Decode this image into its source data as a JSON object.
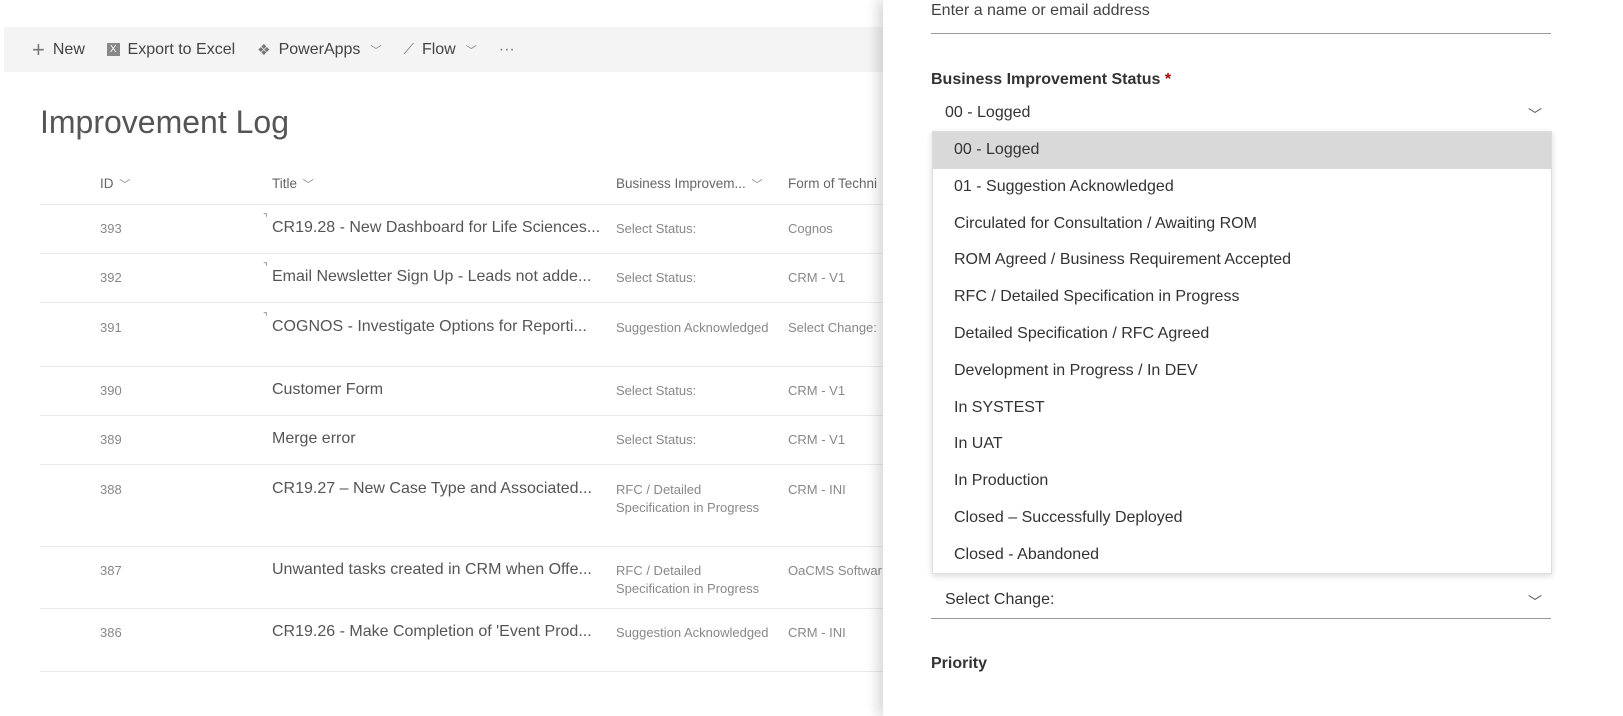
{
  "toolbar": {
    "new": "New",
    "export": "Export to Excel",
    "powerapps": "PowerApps",
    "flow": "Flow",
    "more": "···"
  },
  "list": {
    "title": "Improvement Log",
    "columns": {
      "id": "ID",
      "title": "Title",
      "status": "Business Improvem...",
      "form": "Form of Techni"
    },
    "rows": [
      {
        "id": "393",
        "title": "CR19.28 - New Dashboard for Life Sciences...",
        "status": "Select Status:",
        "form": "Cognos",
        "pin": true
      },
      {
        "id": "392",
        "title": "Email Newsletter Sign Up - Leads not adde...",
        "status": "Select Status:",
        "form": "CRM - V1",
        "pin": true
      },
      {
        "id": "391",
        "title": "COGNOS - Investigate Options for Reporti...",
        "status": "Suggestion Acknowledged",
        "form": "Select Change:",
        "pin": true
      },
      {
        "id": "390",
        "title": "Customer Form",
        "status": "Select Status:",
        "form": "CRM - V1"
      },
      {
        "id": "389",
        "title": "Merge error",
        "status": "Select Status:",
        "form": "CRM - V1"
      },
      {
        "id": "388",
        "title": "CR19.27 – New Case Type and Associated...",
        "status": "RFC / Detailed Specification in Progress",
        "form": "CRM - INI"
      },
      {
        "id": "387",
        "title": "Unwanted tasks created in CRM when Offe...",
        "status": "RFC / Detailed Specification in Progress",
        "form": "OaCMS Softwar"
      },
      {
        "id": "386",
        "title": "CR19.26 - Make Completion of 'Event Prod...",
        "status": "Suggestion Acknowledged",
        "form": "CRM - INI"
      }
    ]
  },
  "panel": {
    "people_placeholder": "Enter a name or email address",
    "status_label": "Business Improvement Status",
    "required": "*",
    "status_value": "00 - Logged",
    "options": [
      "00 - Logged",
      "01 - Suggestion Acknowledged",
      "Circulated for Consultation / Awaiting ROM",
      "ROM Agreed / Business Requirement Accepted",
      "RFC / Detailed Specification in Progress",
      "Detailed Specification / RFC Agreed",
      "Development in Progress / In DEV",
      "In SYSTEST",
      "In UAT",
      "In Production",
      "Closed – Successfully Deployed",
      "Closed - Abandoned"
    ],
    "change_value": "Select Change:",
    "priority_label": "Priority"
  }
}
